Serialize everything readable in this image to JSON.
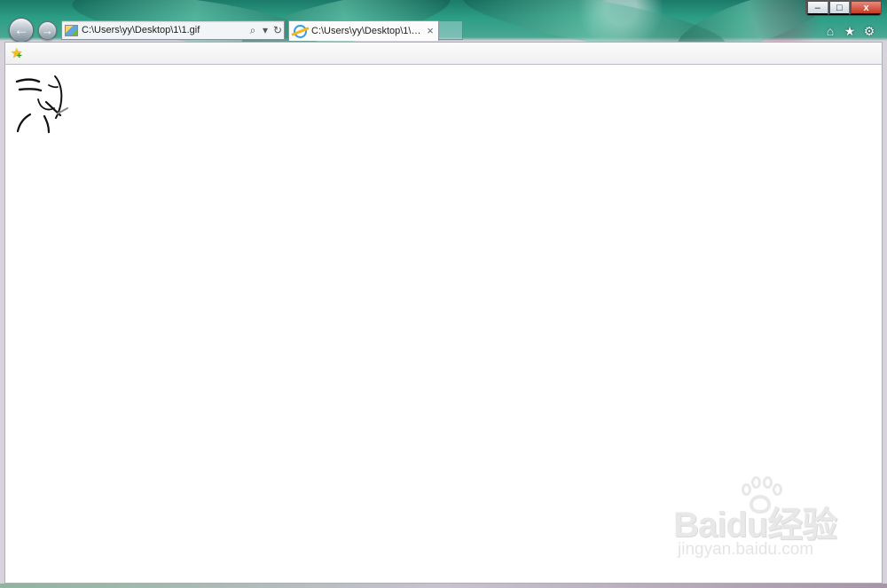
{
  "browser": {
    "address_bar": {
      "url": "C:\\Users\\yy\\Desktop\\1\\1.gif",
      "search_icon": "search-icon",
      "dropdown_icon": "chevron-down-icon",
      "refresh_icon": "refresh-icon"
    },
    "tab": {
      "title": "C:\\Users\\yy\\Desktop\\1\\1...",
      "close_label": "×"
    },
    "navigation": {
      "back_label": "←",
      "forward_label": "→"
    },
    "window_controls": {
      "minimize_label": "–",
      "maximize_label": "□",
      "close_label": "x"
    },
    "toolbar": {
      "home_icon": "home-icon",
      "favorites_icon": "star-icon",
      "tools_icon": "gear-icon",
      "home_label": "⌂",
      "favorites_label": "★",
      "tools_label": "⚙"
    },
    "favorites_bar": {
      "add_favorite_icon": "favorite-add-icon",
      "add_favorite_label": "★"
    },
    "content": {
      "image_icon": "sketch-face-image"
    },
    "watermark": {
      "brand": "Baidu经验",
      "domain": "jingyan.baidu.com"
    },
    "colors": {
      "content_bg": "#ffffff",
      "accent": "#2e9ee8",
      "close_button": "#c63822"
    }
  }
}
